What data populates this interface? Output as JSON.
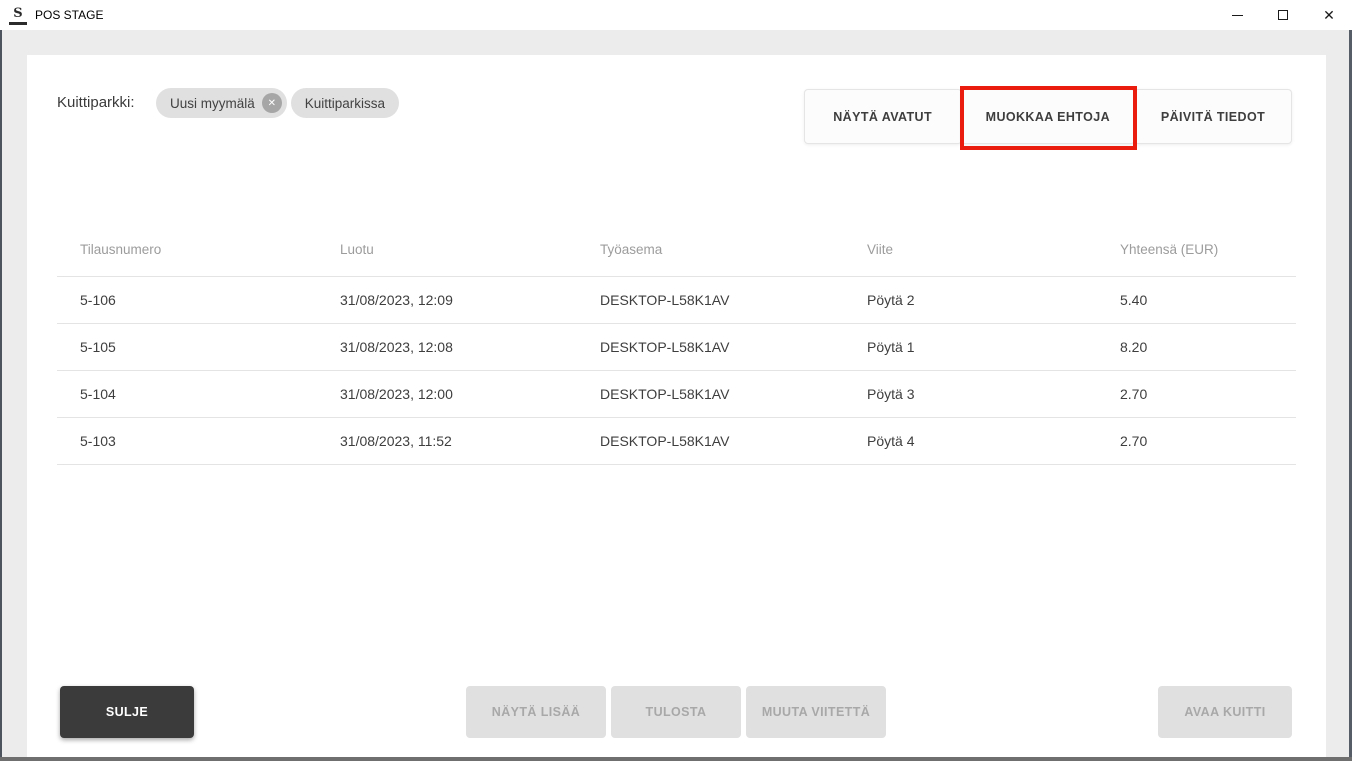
{
  "window": {
    "title": "POS STAGE",
    "logo_glyph": "S",
    "controls": {
      "close_glyph": "✕"
    }
  },
  "filter_bar": {
    "label": "Kuittiparkki:",
    "chips": [
      {
        "label": "Uusi myymälä",
        "remove_icon": "✕"
      },
      {
        "label": "Kuittiparkissa"
      }
    ]
  },
  "toolbar": {
    "show_open_label": "NÄYTÄ AVATUT",
    "edit_conditions_label": "MUOKKAA EHTOJA",
    "refresh_label": "PÄIVITÄ TIEDOT",
    "highlight_color": "#ea1c0d",
    "highlighted_button": "MUOKKAA EHTOJA"
  },
  "table": {
    "columns": [
      "Tilausnumero",
      "Luotu",
      "Työasema",
      "Viite",
      "Yhteensä (EUR)"
    ],
    "rows": [
      [
        "5-106",
        "31/08/2023, 12:09",
        "DESKTOP-L58K1AV",
        "Pöytä 2",
        "5.40"
      ],
      [
        "5-105",
        "31/08/2023, 12:08",
        "DESKTOP-L58K1AV",
        "Pöytä 1",
        "8.20"
      ],
      [
        "5-104",
        "31/08/2023, 12:00",
        "DESKTOP-L58K1AV",
        "Pöytä 3",
        "2.70"
      ],
      [
        "5-103",
        "31/08/2023, 11:52",
        "DESKTOP-L58K1AV",
        "Pöytä 4",
        "2.70"
      ]
    ]
  },
  "footer": {
    "close_label": "SULJE",
    "show_more_label": "NÄYTÄ LISÄÄ",
    "print_label": "TULOSTA",
    "change_reference_label": "MUUTA VIITETTÄ",
    "open_receipt_label": "AVAA KUITTI"
  },
  "colors": {
    "annotation_red": "#ea1c0d",
    "close_button_bg": "#3b3b3b",
    "chip_bg": "#e0e0e0",
    "disabled_button_bg": "#e0e0e0",
    "card_bg": "#ffffff",
    "desktop_bg": "#ececec"
  }
}
